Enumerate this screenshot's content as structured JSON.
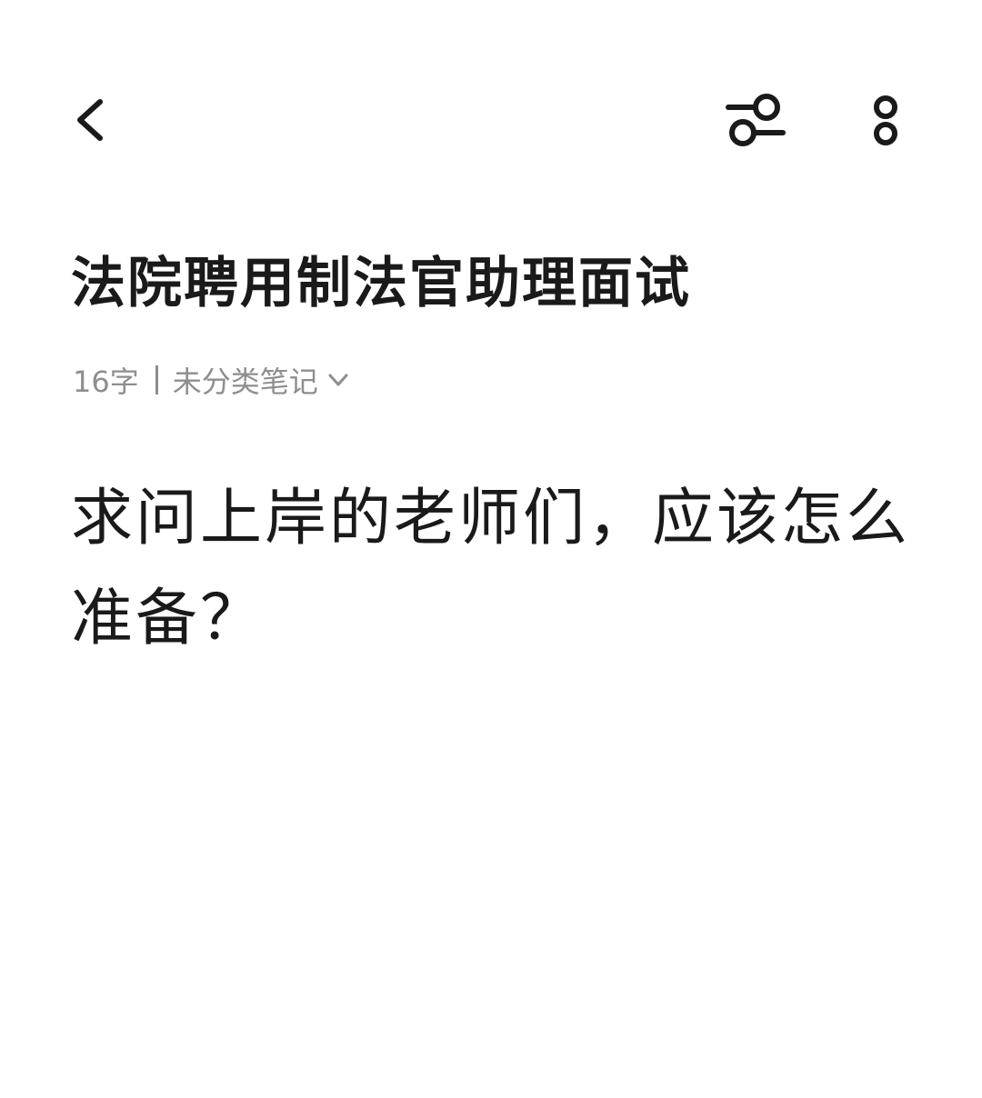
{
  "toolbar": {
    "back_icon": "chevron-left-icon",
    "filter_icon": "sliders-icon",
    "more_icon": "more-vertical-icon"
  },
  "note": {
    "title": "法院聘用制法官助理面试",
    "word_count": "16字",
    "category": "未分类笔记",
    "content": "求问上岸的老师们，应该怎么准备？"
  },
  "colors": {
    "text": "#1a1a1a",
    "meta": "#8e8e8e",
    "background": "#ffffff"
  }
}
